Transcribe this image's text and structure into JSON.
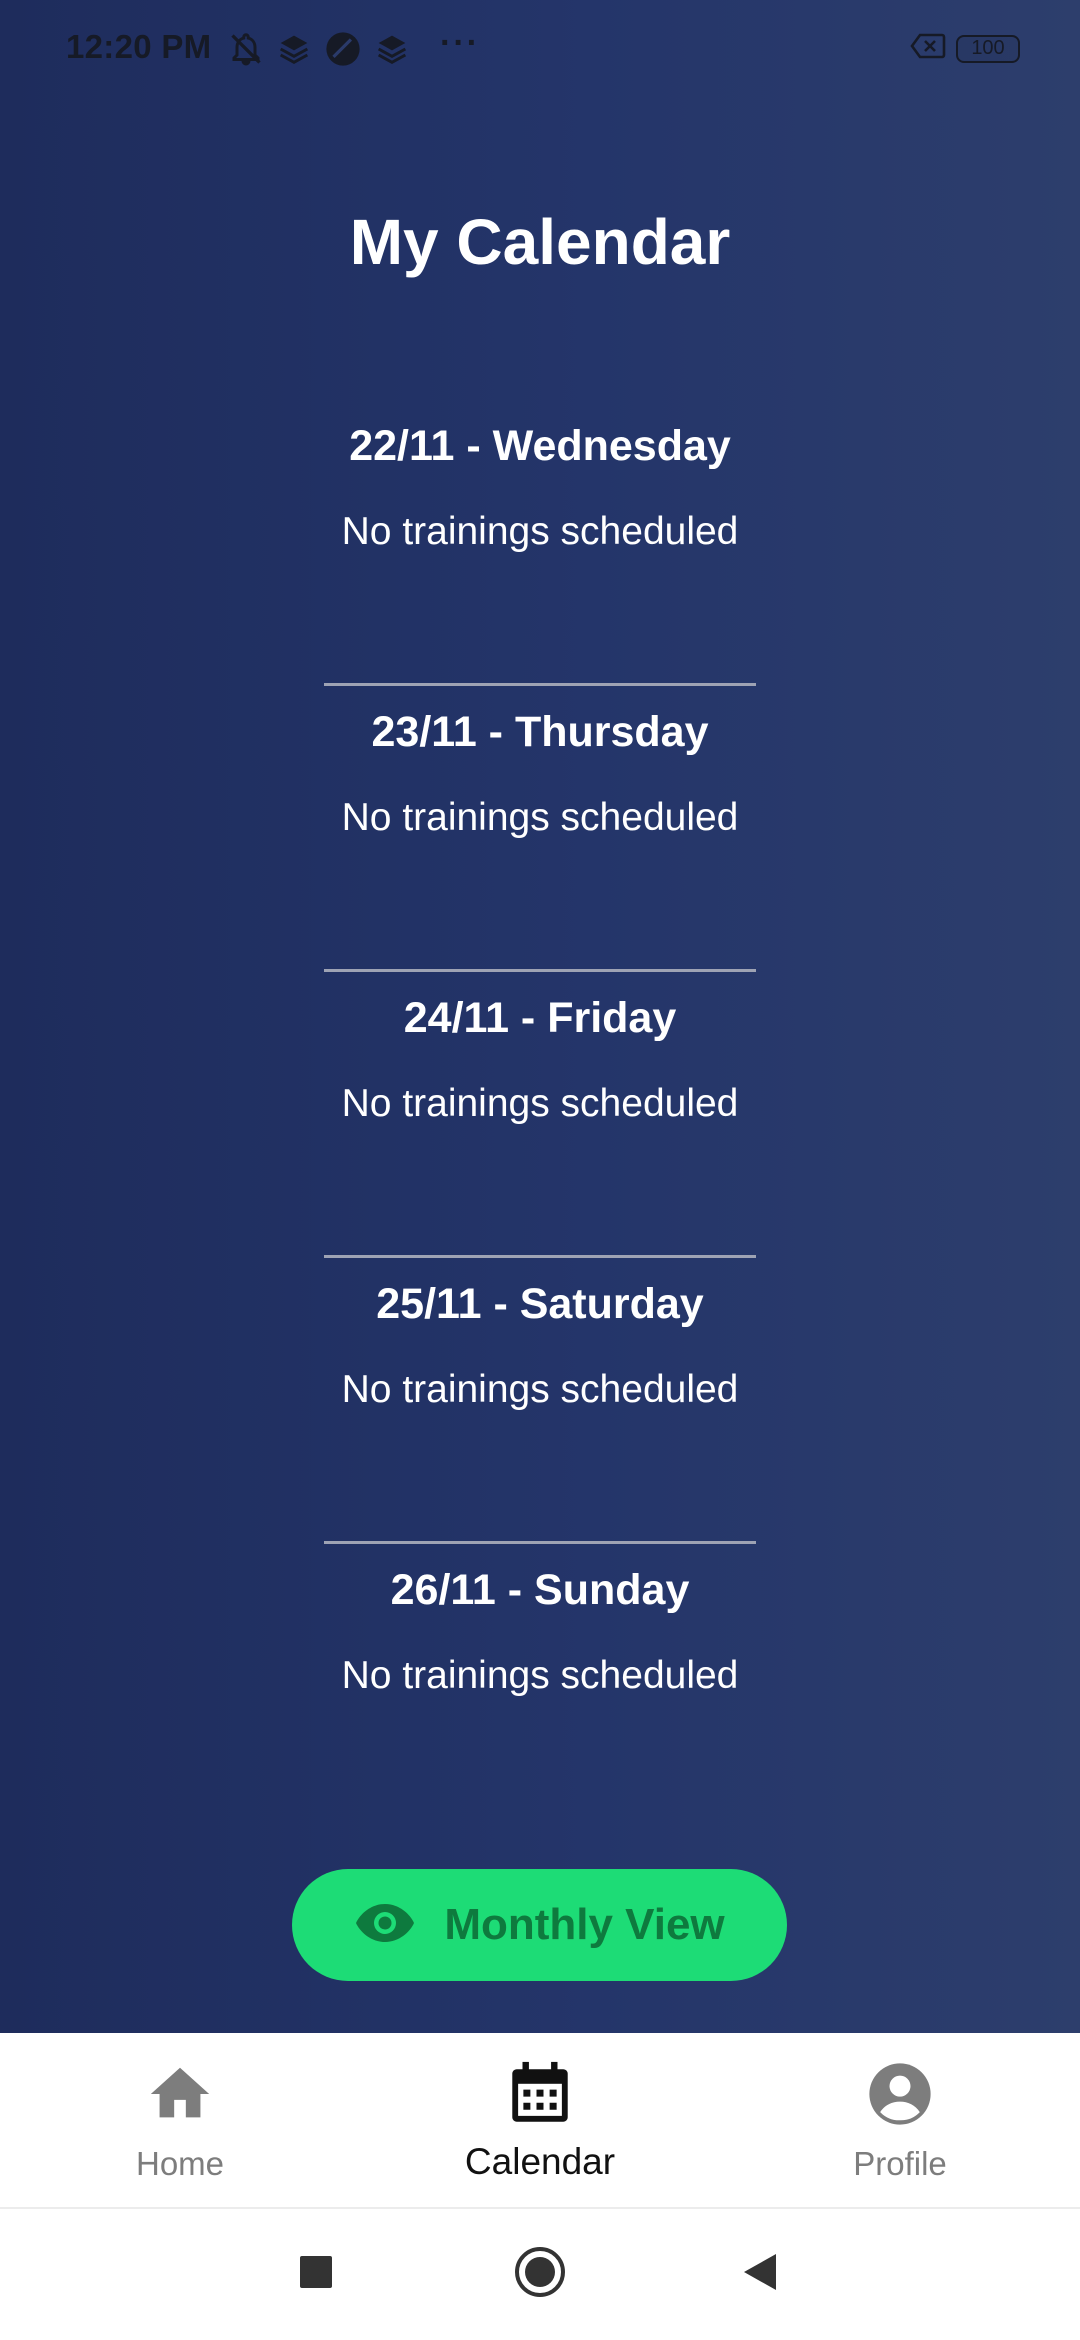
{
  "status_bar": {
    "time": "12:20 PM",
    "overflow": "···",
    "battery": "100",
    "icons_left": [
      "notifications-off-icon",
      "layers-icon",
      "circle-app-icon",
      "layers-icon"
    ],
    "icons_right": [
      "no-sim-icon",
      "battery-icon"
    ]
  },
  "page": {
    "title": "My Calendar"
  },
  "days": [
    {
      "title": "22/11 - Wednesday",
      "note": "No trainings scheduled"
    },
    {
      "title": "23/11 - Thursday",
      "note": "No trainings scheduled"
    },
    {
      "title": "24/11 - Friday",
      "note": "No trainings scheduled"
    },
    {
      "title": "25/11 - Saturday",
      "note": "No trainings scheduled"
    },
    {
      "title": "26/11 - Sunday",
      "note": "No trainings scheduled"
    }
  ],
  "monthly_button": {
    "label": "Monthly View",
    "icon": "eye-icon"
  },
  "bottom_nav": {
    "items": [
      {
        "label": "Home",
        "icon": "home-icon",
        "active": false
      },
      {
        "label": "Calendar",
        "icon": "calendar-icon",
        "active": true
      },
      {
        "label": "Profile",
        "icon": "account-circle-icon",
        "active": false
      }
    ]
  },
  "system_nav": [
    "recents-square-icon",
    "home-circle-icon",
    "back-triangle-icon"
  ],
  "colors": {
    "background": "#24356a",
    "accent_button": "#1ddc76",
    "accent_button_text": "#0e7a3e",
    "divider": "#9ea3b4",
    "nav_inactive": "#7d7d7d",
    "nav_active": "#111111"
  }
}
